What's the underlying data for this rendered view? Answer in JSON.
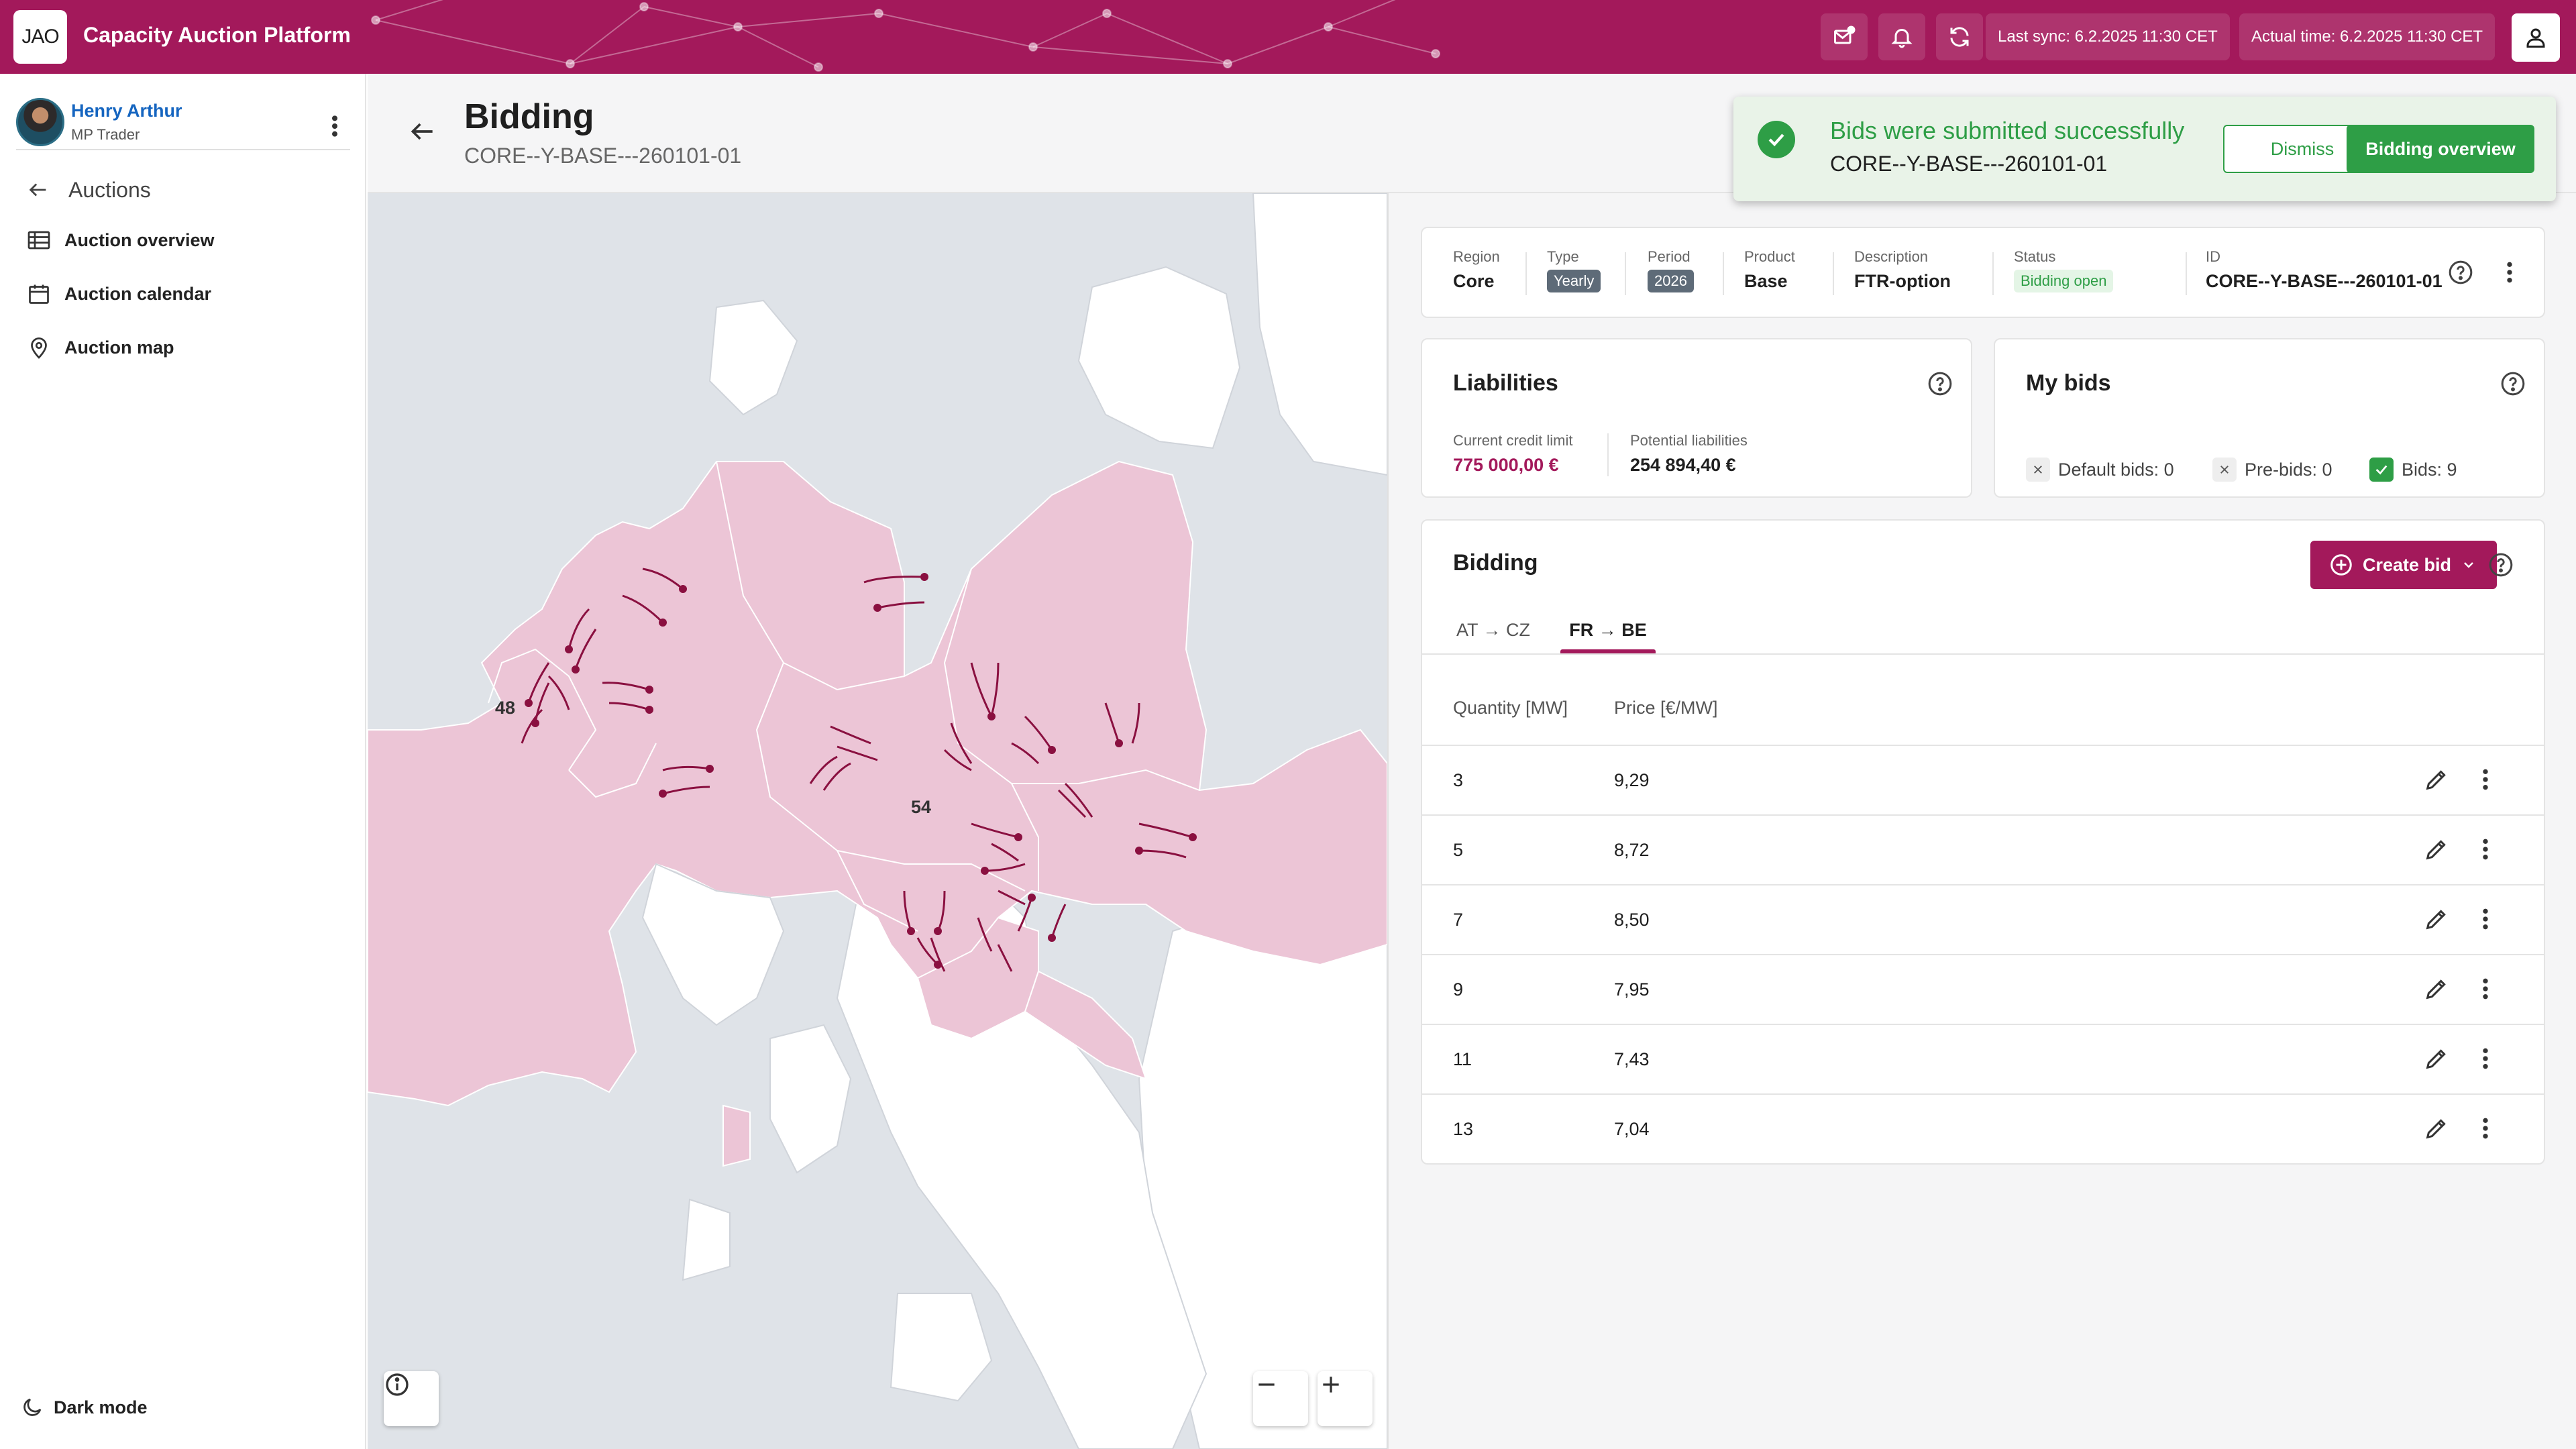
{
  "app": {
    "logo_text": "JAO",
    "title": "Capacity Auction Platform"
  },
  "topbar": {
    "last_sync": "Last sync: 6.2.2025  11:30 CET",
    "actual_time": "Actual time: 6.2.2025  11:30 CET"
  },
  "user": {
    "name": "Henry Arthur",
    "role": "MP Trader"
  },
  "sidebar": {
    "back_label": "Auctions",
    "items": [
      {
        "label": "Auction overview",
        "icon": "table-icon"
      },
      {
        "label": "Auction calendar",
        "icon": "calendar-icon"
      },
      {
        "label": "Auction map",
        "icon": "map-pin-icon"
      }
    ],
    "dark_mode_label": "Dark mode"
  },
  "page": {
    "title": "Bidding",
    "subtitle": "CORE--Y-BASE---260101-01"
  },
  "map": {
    "labels": [
      "48",
      "54"
    ],
    "highlight_color": "#ecc5d6",
    "arrow_color": "#8a1040"
  },
  "auction_info": {
    "fields": [
      {
        "label": "Region",
        "value": "Core"
      },
      {
        "label": "Type",
        "value": "Yearly",
        "chip": "grey"
      },
      {
        "label": "Period",
        "value": "2026",
        "chip": "grey"
      },
      {
        "label": "Product",
        "value": "Base"
      },
      {
        "label": "Description",
        "value": "FTR-option"
      },
      {
        "label": "Status",
        "value": "Bidding open",
        "chip": "green"
      },
      {
        "label": "ID",
        "value": "CORE--Y-BASE---260101-01"
      }
    ]
  },
  "liabilities": {
    "title": "Liabilities",
    "credit_label": "Current credit limit",
    "credit_value": "775 000,00 €",
    "potential_label": "Potential liabilities",
    "potential_value": "254 894,40 €"
  },
  "my_bids": {
    "title": "My bids",
    "default_bids": "Default bids: 0",
    "pre_bids": "Pre-bids: 0",
    "bids": "Bids: 9"
  },
  "bidding": {
    "title": "Bidding",
    "create_label": "Create bid",
    "tabs": [
      "AT → CZ",
      "FR → BE"
    ],
    "active_tab": "FR → BE",
    "columns": [
      "Quantity [MW]",
      "Price [€/MW]"
    ],
    "rows": [
      {
        "quantity": "3",
        "price": "9,29"
      },
      {
        "quantity": "5",
        "price": "8,72"
      },
      {
        "quantity": "7",
        "price": "8,50"
      },
      {
        "quantity": "9",
        "price": "7,95"
      },
      {
        "quantity": "11",
        "price": "7,43"
      },
      {
        "quantity": "13",
        "price": "7,04"
      }
    ]
  },
  "toast": {
    "title": "Bids were submitted successfully",
    "subtitle": "CORE--Y-BASE---260101-01",
    "dismiss_label": "Dismiss",
    "overview_label": "Bidding overview"
  },
  "colors": {
    "brand": "#a3195b",
    "success": "#2e9e46"
  }
}
